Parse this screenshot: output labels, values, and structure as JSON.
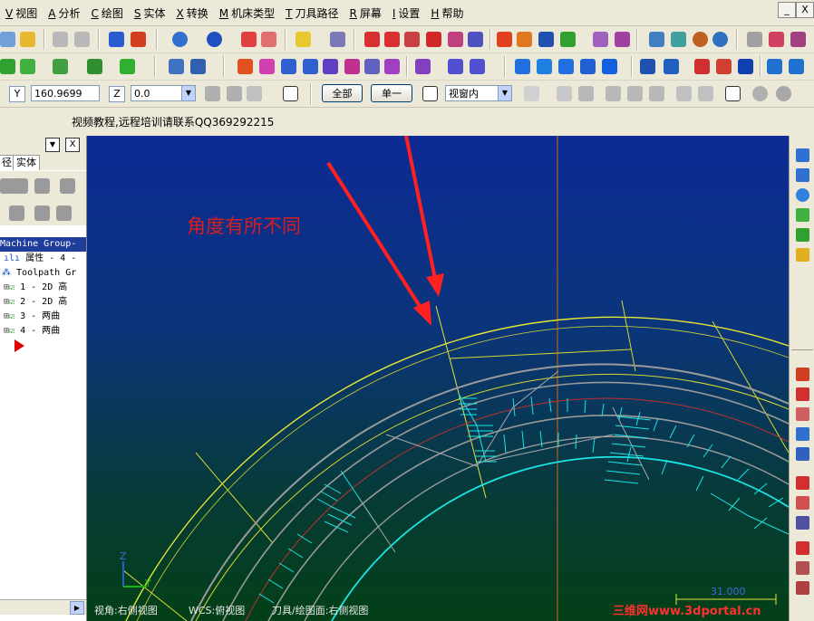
{
  "menu": [
    {
      "key": "V",
      "label": "视图"
    },
    {
      "key": "A",
      "label": "分析"
    },
    {
      "key": "C",
      "label": "绘图"
    },
    {
      "key": "S",
      "label": "实体"
    },
    {
      "key": "X",
      "label": "转换"
    },
    {
      "key": "M",
      "label": "机床类型"
    },
    {
      "key": "T",
      "label": "刀具路径"
    },
    {
      "key": "R",
      "label": "屏幕"
    },
    {
      "key": "I",
      "label": "设置"
    },
    {
      "key": "H",
      "label": "帮助"
    }
  ],
  "window_buttons": {
    "min": "_",
    "close": "X"
  },
  "autocursor": {
    "y_label": "Y",
    "y_value": "160.9699",
    "z_label": "Z",
    "z_value": "0.0",
    "all_button": "全部",
    "single_button": "单一",
    "mode_value": "视窗内"
  },
  "info_text": "视频教程,远程培训请联系QQ369292215",
  "left_panel": {
    "tab_path": "径",
    "tab_solid": "实体",
    "close_glyph": "X",
    "tree": [
      "Machine Group-",
      "属性 - 4 -",
      "Toolpath Gr",
      "1 - 2D 高",
      "2 - 2D 高",
      "3 - 两曲",
      "4 - 两曲"
    ]
  },
  "viewport": {
    "annotation": "角度有所不同",
    "axis_x": "Y",
    "axis_z": "Z",
    "scale_label": "31.000"
  },
  "status_bar": {
    "view": "视角:右侧视图",
    "wcs": "WCS:俯视图",
    "plane": "刀具/绘图面:右侧视图"
  },
  "watermark": "三维网www.3dportal.cn",
  "colors": {
    "viewport_top": "#0d2a95",
    "viewport_bottom": "#034017",
    "geometry_yellow": "#e5e532",
    "toolpath_cyan": "#19e6e6",
    "boundary_grey": "#9a9a9a",
    "arrow_red": "#ff2020",
    "annotation_red": "#d81e1e"
  }
}
